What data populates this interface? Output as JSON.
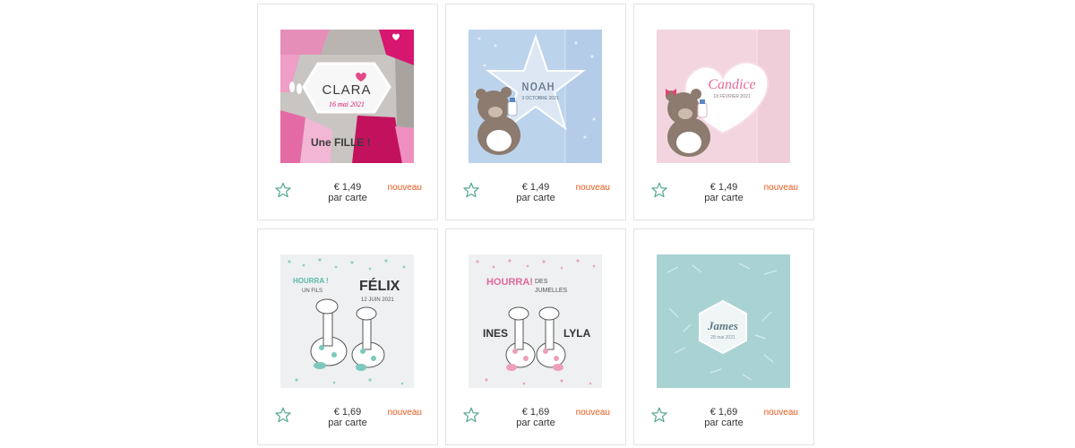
{
  "products": [
    {
      "price": "€ 1,49",
      "unit": "par carte",
      "badge": "nouveau",
      "art": {
        "name": "CLARA",
        "date": "16 mai 2021",
        "extra": "Une FILLE !"
      }
    },
    {
      "price": "€ 1,49",
      "unit": "par carte",
      "badge": "nouveau",
      "art": {
        "name": "NOAH",
        "date": "3 OCTOBRE 2021"
      }
    },
    {
      "price": "€ 1,49",
      "unit": "par carte",
      "badge": "nouveau",
      "art": {
        "name": "Candice",
        "date": "18 FÉVRIER 2021"
      }
    },
    {
      "price": "€ 1,69",
      "unit": "par carte",
      "badge": "nouveau",
      "art": {
        "name": "FÉLIX",
        "date": "12 JUIN 2021",
        "line1": "HOURRA !",
        "line2": "UN FILS"
      }
    },
    {
      "price": "€ 1,69",
      "unit": "par carte",
      "badge": "nouveau",
      "art": {
        "line1": "HOURRA!",
        "line2": "DES",
        "line3": "JUMELLES",
        "name1": "INES",
        "name2": "LYLA"
      }
    },
    {
      "price": "€ 1,69",
      "unit": "par carte",
      "badge": "nouveau",
      "art": {
        "name": "James",
        "date": "28 mai 2021"
      }
    }
  ],
  "colors": {
    "accent": "#e8591a",
    "star": "#5aa898",
    "border": "#e3e3e3"
  },
  "icons": {
    "favorite": "star-outline-icon"
  }
}
